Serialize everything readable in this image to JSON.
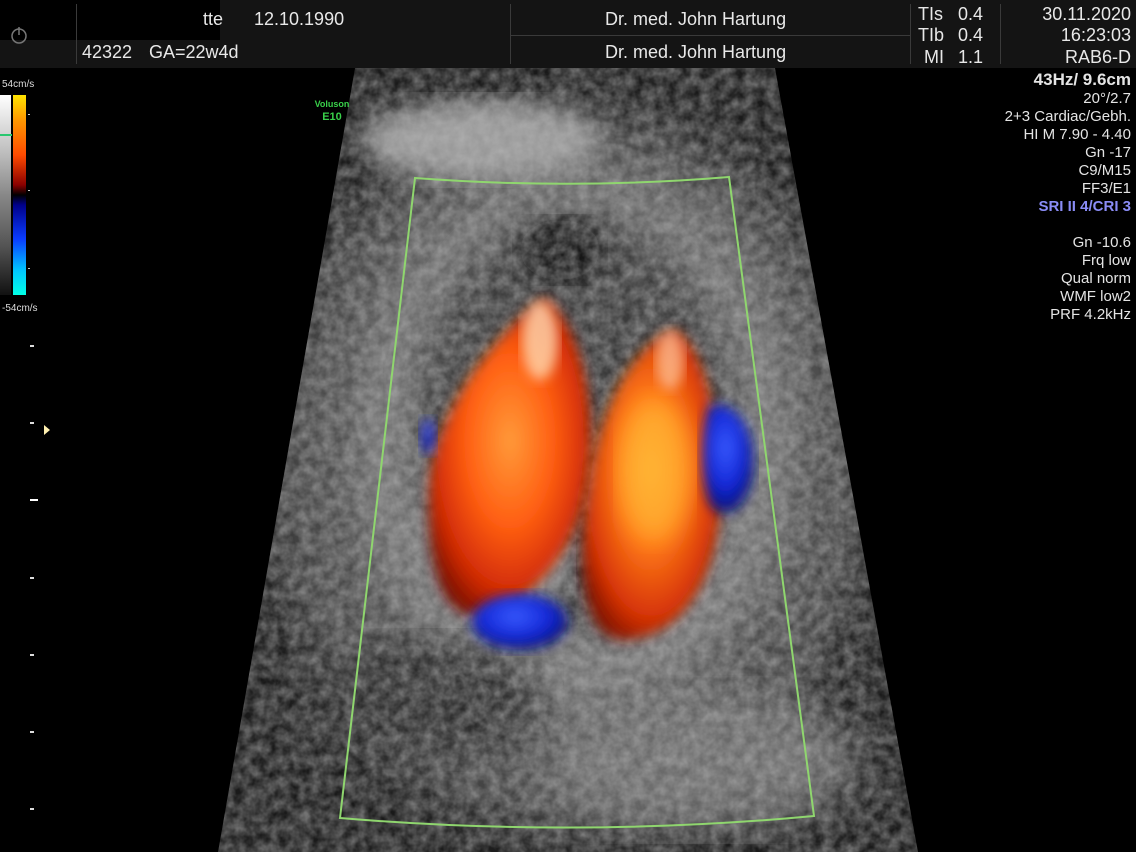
{
  "header": {
    "patient_name_partial": "tte",
    "birth_date": "12.10.1990",
    "patient_id": "42322",
    "gestational_age": "GA=22w4d",
    "physician_1": "Dr. med. John Hartung",
    "physician_2": "Dr. med. John Hartung",
    "tis_label": "TIs",
    "tis_value": "0.4",
    "tib_label": "TIb",
    "tib_value": "0.4",
    "mi_label": "MI",
    "mi_value": "1.1",
    "date": "30.11.2020",
    "time": "16:23:03",
    "probe": "RAB6-D"
  },
  "colorbar": {
    "max_label": "54cm/s",
    "min_label": "-54cm/s"
  },
  "logo": {
    "line1": "Voluson",
    "line2": "E10"
  },
  "params": {
    "frame_depth": "43Hz/ 9.6cm",
    "angle": "20°/2.7",
    "preset": "2+3 Cardiac/Gebh.",
    "harmonic": "HI M  7.90 - 4.40",
    "gain": "Gn -17",
    "cm": "C9/M15",
    "ff": "FF3/E1",
    "sri": "SRI II 4/CRI 3",
    "color_gain": "Gn -10.6",
    "frq": "Frq low",
    "qual": "Qual norm",
    "wmf": "WMF low2",
    "prf": "PRF  4.2kHz"
  },
  "colors": {
    "roi_outline": "#8fd66e",
    "sri_blue": "#8a8cf5",
    "logo_green": "#39d04a"
  }
}
